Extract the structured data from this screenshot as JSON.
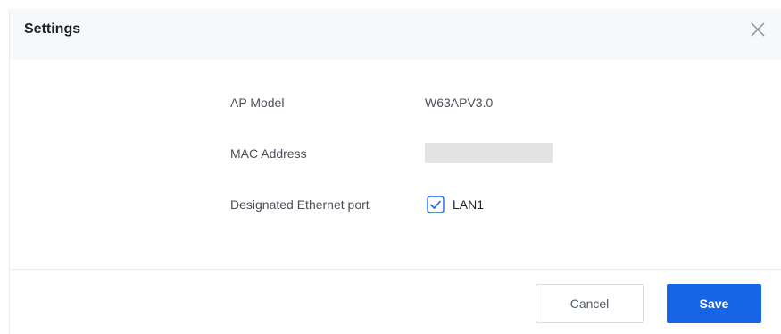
{
  "dialog": {
    "title": "Settings",
    "close_icon": "close-icon"
  },
  "fields": {
    "ap_model_label": "AP Model",
    "ap_model_value": "W63APV3.0",
    "mac_address_label": "MAC Address",
    "ethernet_port_label": "Designated Ethernet port",
    "ethernet_port_option": "LAN1",
    "ethernet_port_checked": true
  },
  "footer": {
    "cancel_label": "Cancel",
    "save_label": "Save"
  },
  "colors": {
    "accent": "#1665e6",
    "header_bg": "#f7f8fa",
    "mask": "#e3e3e3"
  }
}
